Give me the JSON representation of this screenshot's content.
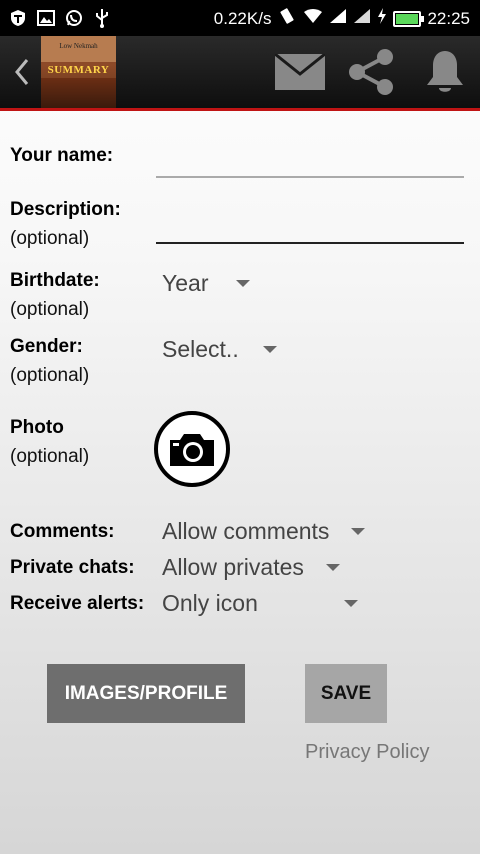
{
  "status_bar": {
    "speed": "0.22K/s",
    "time": "22:25",
    "left_icons": [
      "shield-t-icon",
      "image-icon",
      "whatsapp-icon",
      "usb-icon"
    ],
    "right_icons": [
      "vibrate-icon",
      "wifi-icon",
      "signal-icon",
      "signal-icon",
      "charging-icon",
      "battery-icon"
    ]
  },
  "action_bar": {
    "book_cover": {
      "author_line": "Low Nekmah",
      "title": "SUMMARY"
    },
    "icons": [
      "back-icon",
      "mail-icon",
      "share-icon",
      "bell-icon"
    ],
    "accent_color": "#c01414"
  },
  "form": {
    "name_label": "Your name:",
    "description_label": "Description:",
    "description_sub": "(optional)",
    "birthdate_label": "Birthdate:",
    "birthdate_sub": "(optional)",
    "birthdate_value": "Year",
    "gender_label": "Gender:",
    "gender_sub": "(optional)",
    "gender_value": "Select..",
    "photo_label": "Photo",
    "photo_sub": "(optional)",
    "comments_label": "Comments:",
    "comments_value": "Allow comments",
    "private_chats_label": "Private chats:",
    "private_chats_value": "Allow privates",
    "receive_alerts_label": "Receive alerts:",
    "receive_alerts_value": "Only icon"
  },
  "buttons": {
    "images_profile": "IMAGES/PROFILE",
    "save": "SAVE"
  },
  "privacy_link": "Privacy Policy"
}
